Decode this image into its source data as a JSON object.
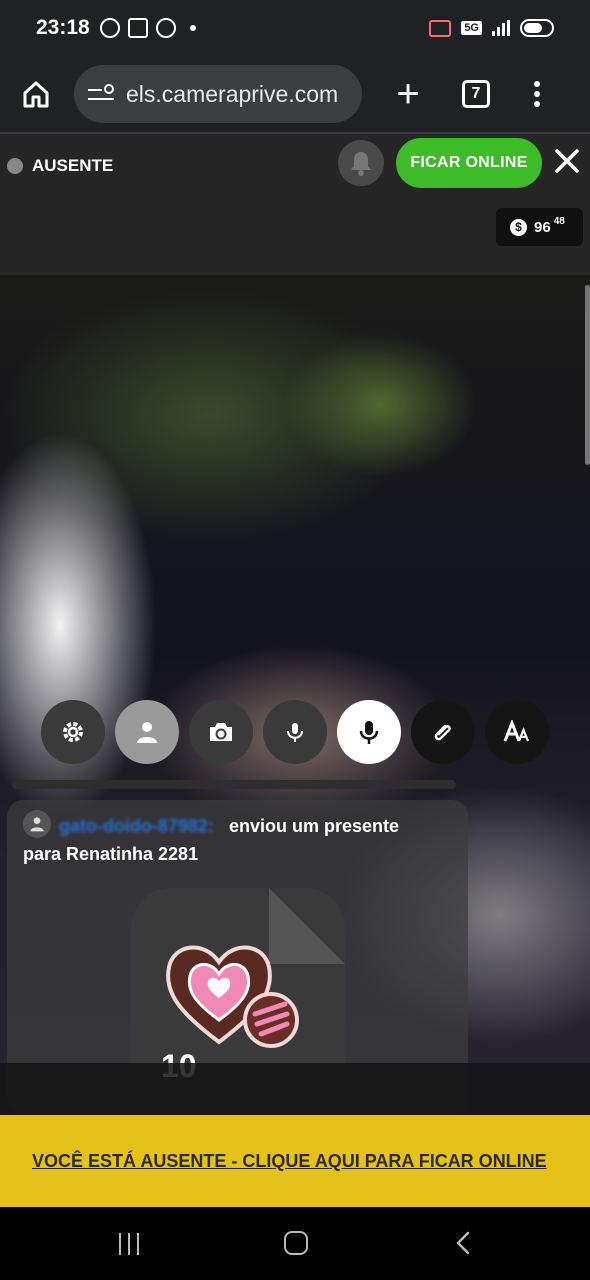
{
  "statusbar": {
    "time": "23:18",
    "network": "5G",
    "icons": [
      "whatsapp-icon",
      "screenshot-icon",
      "whatsapp-icon",
      "notification-dot",
      "cast-icon",
      "signal-icon",
      "battery-icon"
    ]
  },
  "browser": {
    "url": "els.cameraprive.com",
    "tab_count": "7",
    "icons": [
      "home-icon",
      "site-settings-icon",
      "new-tab-plus-icon",
      "tabs-counter-icon",
      "more-vert-icon"
    ]
  },
  "header": {
    "status_label": "AUSENTE",
    "online_button": "FICAR ONLINE",
    "credits_main": "96",
    "credits_cents": "48",
    "credits_symbol": "$",
    "colors": {
      "online_green": "#3dbb28",
      "status_gray": "#888888"
    }
  },
  "controls": {
    "icons": [
      "settings-gear-icon",
      "user-icon",
      "camera-switch-icon",
      "voice-effect-icon",
      "microphone-icon",
      "attachment-clip-icon",
      "font-size-icon"
    ]
  },
  "chat": {
    "username": "gato-doido-87982:",
    "message_part1": "enviou um presente",
    "message_part2": "para Renatinha 2281",
    "gift_count": "10",
    "gift_icon": "chocolate-heart-gift-icon"
  },
  "away_banner": {
    "text": "VOCÊ ESTÁ AUSENTE - CLIQUE AQUI PARA FICAR ONLINE",
    "color": "#e5c21a"
  },
  "navbar": {
    "icons": [
      "recent-apps-icon",
      "home-circle-icon",
      "back-icon"
    ]
  }
}
